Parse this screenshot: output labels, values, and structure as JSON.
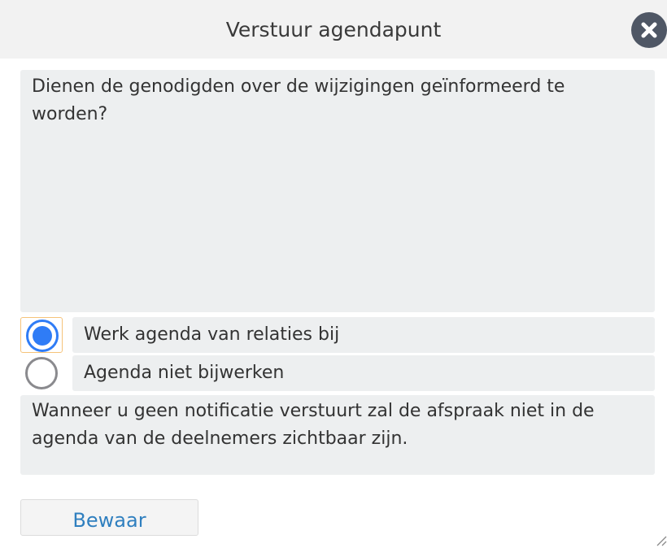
{
  "dialog": {
    "title": "Verstuur agendapunt",
    "close_icon": "close-icon"
  },
  "question": "Dienen de genodigden over de wijzigingen geïnformeerd te worden?",
  "options": [
    {
      "label": "Werk agenda van relaties bij",
      "selected": true
    },
    {
      "label": "Agenda niet bijwerken",
      "selected": false
    }
  ],
  "notice": "Wanneer u geen notificatie verstuurt zal de afspraak niet in de agenda van de deelnemers zichtbaar zijn.",
  "save_button": {
    "label": "Bewaar"
  },
  "colors": {
    "accent": "#2f7cf6",
    "link": "#2f7fbf",
    "panel": "#edeff0",
    "close_button": "#4f5765"
  }
}
